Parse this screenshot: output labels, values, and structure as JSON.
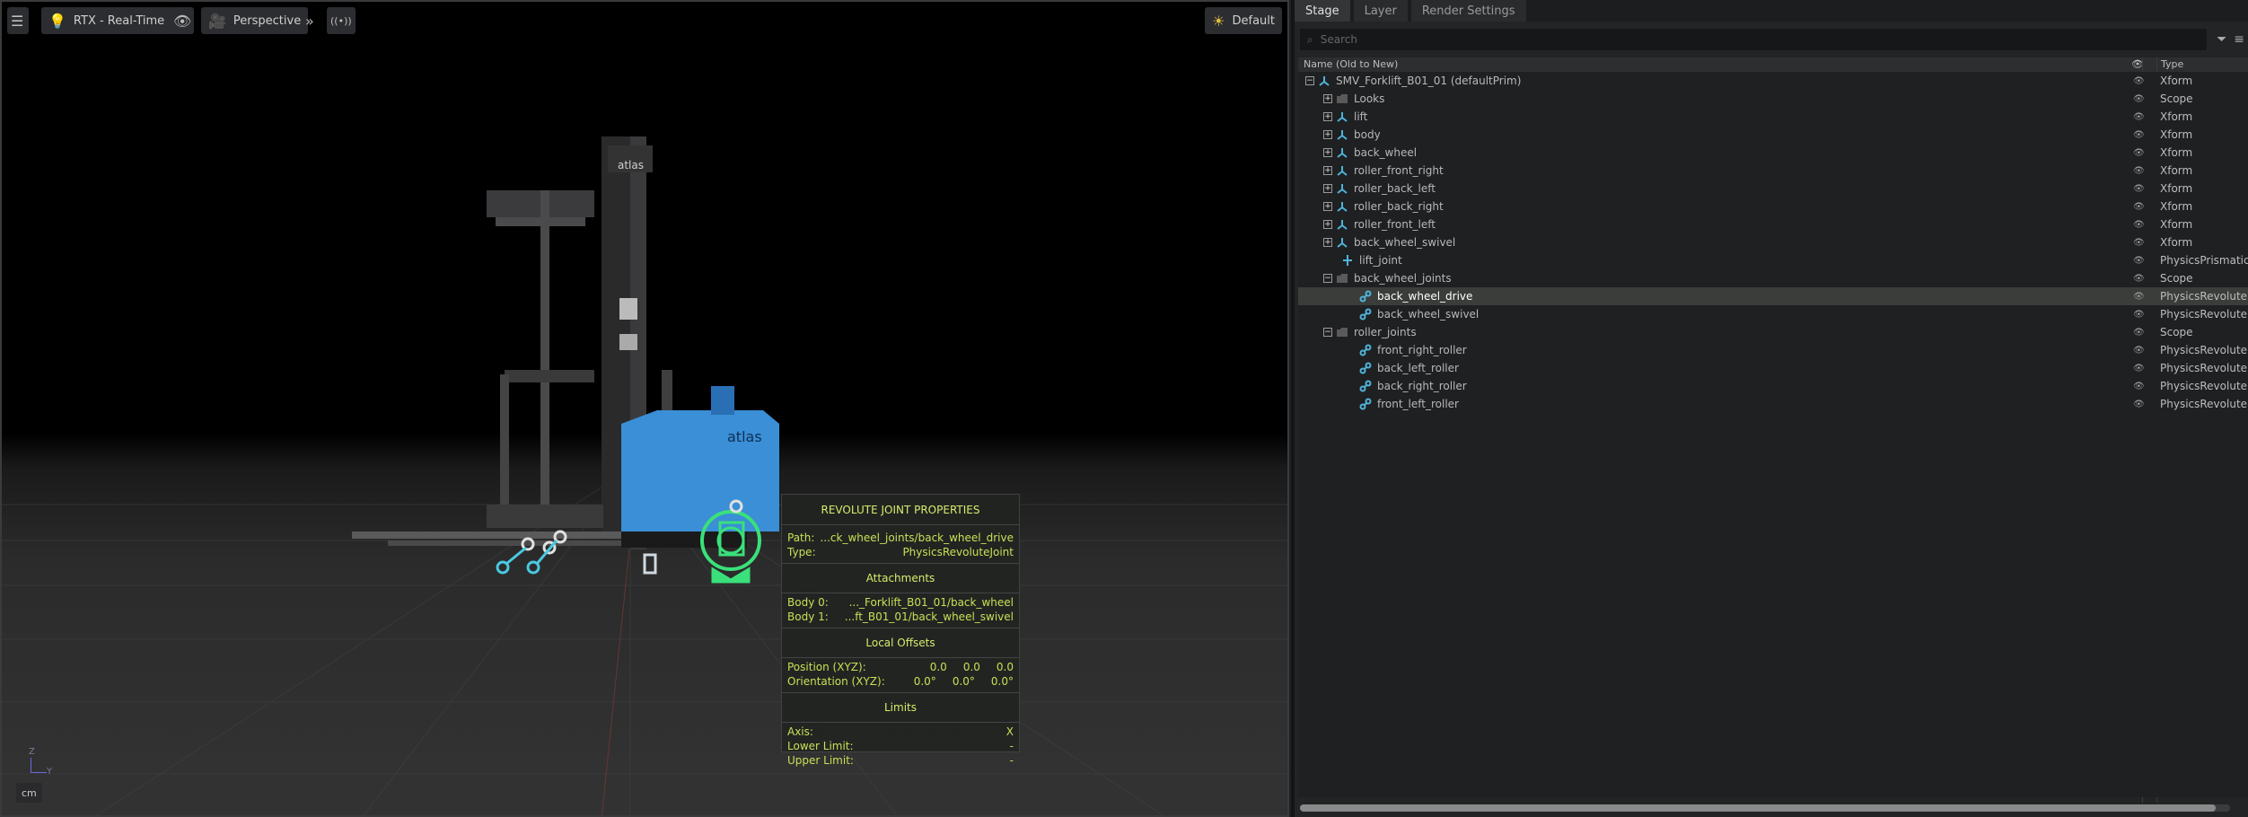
{
  "viewport": {
    "settings_icon": "sliders-icon",
    "renderer": "RTX - Real-Time",
    "camera": "Perspective",
    "lighting": "Default",
    "units": "cm",
    "axis_z": "Z",
    "axis_y": "Y"
  },
  "joint_panel": {
    "title": "REVOLUTE JOINT PROPERTIES",
    "path_label": "Path:",
    "path_value": "...ck_wheel_joints/back_wheel_drive",
    "type_label": "Type:",
    "type_value": "PhysicsRevoluteJoint",
    "attachments_title": "Attachments",
    "body0_label": "Body 0:",
    "body0_value": "..._Forklift_B01_01/back_wheel",
    "body1_label": "Body 1:",
    "body1_value": "...ft_B01_01/back_wheel_swivel",
    "offsets_title": "Local Offsets",
    "position_label": "Position (XYZ):",
    "position_values": [
      "0.0",
      "0.0",
      "0.0"
    ],
    "orientation_label": "Orientation (XYZ):",
    "orientation_values": [
      "0.0°",
      "0.0°",
      "0.0°"
    ],
    "limits_title": "Limits",
    "axis_label": "Axis:",
    "axis_value": "X",
    "lower_label": "Lower Limit:",
    "lower_value": "-",
    "upper_label": "Upper Limit:",
    "upper_value": "-"
  },
  "stage": {
    "tabs": [
      "Stage",
      "Layer",
      "Render Settings"
    ],
    "search_placeholder": "Search",
    "col_name": "Name (Old to New)",
    "col_type": "Type",
    "rows": [
      {
        "label": "SMV_Forklift_B01_01 (defaultPrim)",
        "type": "Xform",
        "icon": "xform"
      },
      {
        "label": "Looks",
        "type": "Scope",
        "icon": "folder"
      },
      {
        "label": "lift",
        "type": "Xform",
        "icon": "xform"
      },
      {
        "label": "body",
        "type": "Xform",
        "icon": "xform"
      },
      {
        "label": "back_wheel",
        "type": "Xform",
        "icon": "xform"
      },
      {
        "label": "roller_front_right",
        "type": "Xform",
        "icon": "xform"
      },
      {
        "label": "roller_back_left",
        "type": "Xform",
        "icon": "xform"
      },
      {
        "label": "roller_back_right",
        "type": "Xform",
        "icon": "xform"
      },
      {
        "label": "roller_front_left",
        "type": "Xform",
        "icon": "xform"
      },
      {
        "label": "back_wheel_swivel",
        "type": "Xform",
        "icon": "xform"
      },
      {
        "label": "lift_joint",
        "type": "PhysicsPrismatic",
        "icon": "prismatic"
      },
      {
        "label": "back_wheel_joints",
        "type": "Scope",
        "icon": "folder"
      },
      {
        "label": "back_wheel_drive",
        "type": "PhysicsRevolute",
        "icon": "revolute"
      },
      {
        "label": "back_wheel_swivel",
        "type": "PhysicsRevolute",
        "icon": "revolute"
      },
      {
        "label": "roller_joints",
        "type": "Scope",
        "icon": "folder"
      },
      {
        "label": "front_right_roller",
        "type": "PhysicsRevolute",
        "icon": "revolute"
      },
      {
        "label": "back_left_roller",
        "type": "PhysicsRevolute",
        "icon": "revolute"
      },
      {
        "label": "back_right_roller",
        "type": "PhysicsRevolute",
        "icon": "revolute"
      },
      {
        "label": "front_left_roller",
        "type": "PhysicsRevolute",
        "icon": "revolute"
      }
    ]
  },
  "logo_text": "atlas"
}
